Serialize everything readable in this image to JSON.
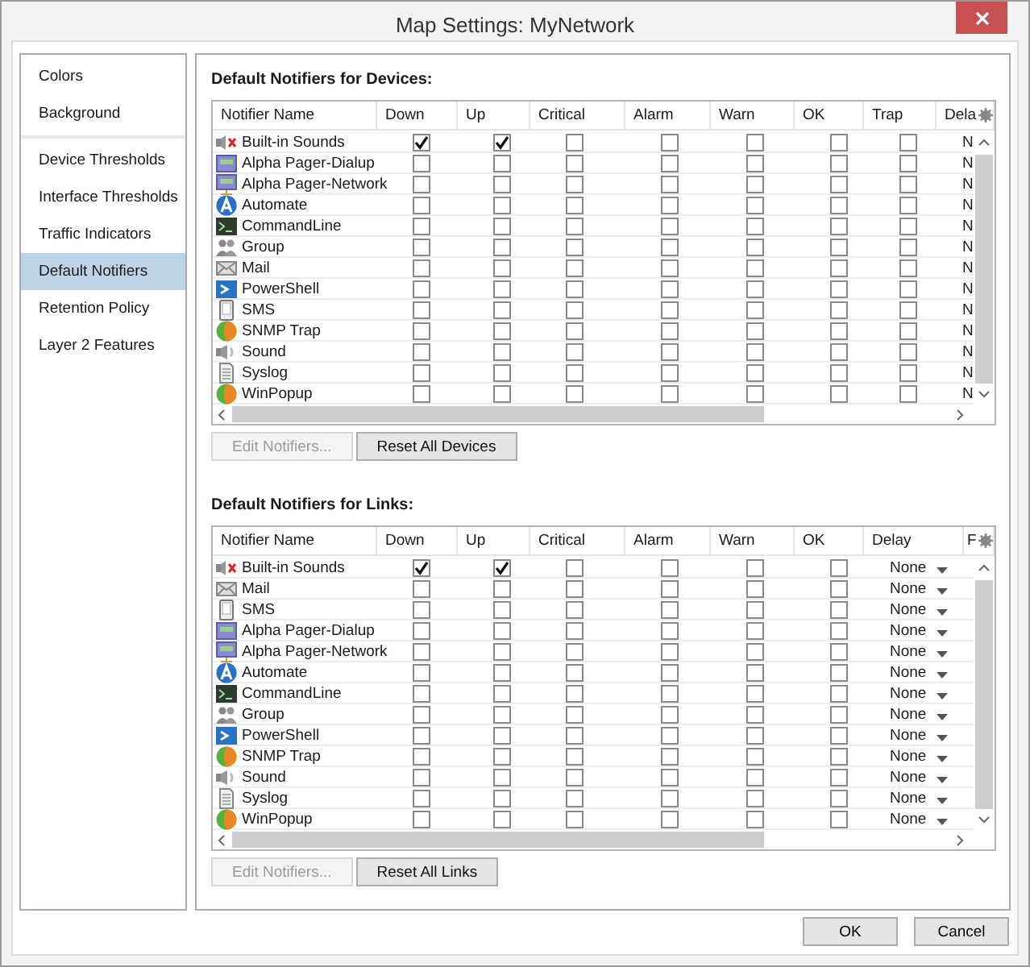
{
  "window": {
    "title": "Map Settings: MyNetwork"
  },
  "sidebar": {
    "groups": [
      {
        "items": [
          {
            "label": "Colors",
            "selected": false
          },
          {
            "label": "Background",
            "selected": false
          }
        ]
      },
      {
        "items": [
          {
            "label": "Device Thresholds",
            "selected": false
          },
          {
            "label": "Interface Thresholds",
            "selected": false
          },
          {
            "label": "Traffic Indicators",
            "selected": false
          },
          {
            "label": "Default Notifiers",
            "selected": true
          },
          {
            "label": "Retention Policy",
            "selected": false
          },
          {
            "label": "Layer 2 Features",
            "selected": false
          }
        ]
      }
    ]
  },
  "devices": {
    "heading": "Default Notifiers for Devices:",
    "columns": [
      {
        "label": "Notifier Name",
        "kind": "name"
      },
      {
        "label": "Down",
        "kind": "check"
      },
      {
        "label": "Up",
        "kind": "check"
      },
      {
        "label": "Critical",
        "kind": "check"
      },
      {
        "label": "Alarm",
        "kind": "check"
      },
      {
        "label": "Warn",
        "kind": "check"
      },
      {
        "label": "OK",
        "kind": "check"
      },
      {
        "label": "Trap",
        "kind": "check"
      },
      {
        "label": "Dela",
        "kind": "delay"
      }
    ],
    "rows": [
      {
        "name": "Built-in Sounds",
        "kind": "sound-muted",
        "checks": [
          true,
          true,
          false,
          false,
          false,
          false,
          false
        ],
        "delay": "N"
      },
      {
        "name": "Alpha Pager-Dialup",
        "kind": "pager",
        "checks": [
          false,
          false,
          false,
          false,
          false,
          false,
          false
        ],
        "delay": "N"
      },
      {
        "name": "Alpha Pager-Network",
        "kind": "pager-network",
        "checks": [
          false,
          false,
          false,
          false,
          false,
          false,
          false
        ],
        "delay": "N"
      },
      {
        "name": "Automate",
        "kind": "automate",
        "checks": [
          false,
          false,
          false,
          false,
          false,
          false,
          false
        ],
        "delay": "N"
      },
      {
        "name": "CommandLine",
        "kind": "terminal",
        "checks": [
          false,
          false,
          false,
          false,
          false,
          false,
          false
        ],
        "delay": "N"
      },
      {
        "name": "Group",
        "kind": "group",
        "checks": [
          false,
          false,
          false,
          false,
          false,
          false,
          false
        ],
        "delay": "N"
      },
      {
        "name": "Mail",
        "kind": "mail",
        "checks": [
          false,
          false,
          false,
          false,
          false,
          false,
          false
        ],
        "delay": "N"
      },
      {
        "name": "PowerShell",
        "kind": "powershell",
        "checks": [
          false,
          false,
          false,
          false,
          false,
          false,
          false
        ],
        "delay": "N"
      },
      {
        "name": "SMS",
        "kind": "phone",
        "checks": [
          false,
          false,
          false,
          false,
          false,
          false,
          false
        ],
        "delay": "N"
      },
      {
        "name": "SNMP Trap",
        "kind": "ball",
        "checks": [
          false,
          false,
          false,
          false,
          false,
          false,
          false
        ],
        "delay": "N"
      },
      {
        "name": "Sound",
        "kind": "sound",
        "checks": [
          false,
          false,
          false,
          false,
          false,
          false,
          false
        ],
        "delay": "N"
      },
      {
        "name": "Syslog",
        "kind": "document",
        "checks": [
          false,
          false,
          false,
          false,
          false,
          false,
          false
        ],
        "delay": "N"
      },
      {
        "name": "WinPopup",
        "kind": "ball",
        "checks": [
          false,
          false,
          false,
          false,
          false,
          false,
          false
        ],
        "delay": "N"
      }
    ],
    "buttons": [
      {
        "label": "Edit Notifiers...",
        "disabled": true
      },
      {
        "label": "Reset All Devices",
        "disabled": false
      }
    ]
  },
  "links": {
    "heading": "Default Notifiers for Links:",
    "columns": [
      {
        "label": "Notifier Name",
        "kind": "name"
      },
      {
        "label": "Down",
        "kind": "check"
      },
      {
        "label": "Up",
        "kind": "check"
      },
      {
        "label": "Critical",
        "kind": "check"
      },
      {
        "label": "Alarm",
        "kind": "check"
      },
      {
        "label": "Warn",
        "kind": "check"
      },
      {
        "label": "OK",
        "kind": "check"
      },
      {
        "label": "Delay",
        "kind": "dropdown"
      },
      {
        "label": "F",
        "kind": "blank"
      }
    ],
    "rows": [
      {
        "name": "Built-in Sounds",
        "kind": "sound-muted",
        "checks": [
          true,
          true,
          false,
          false,
          false,
          false
        ],
        "delay": "None"
      },
      {
        "name": "Mail",
        "kind": "mail",
        "checks": [
          false,
          false,
          false,
          false,
          false,
          false
        ],
        "delay": "None"
      },
      {
        "name": "SMS",
        "kind": "phone",
        "checks": [
          false,
          false,
          false,
          false,
          false,
          false
        ],
        "delay": "None"
      },
      {
        "name": "Alpha Pager-Dialup",
        "kind": "pager",
        "checks": [
          false,
          false,
          false,
          false,
          false,
          false
        ],
        "delay": "None"
      },
      {
        "name": "Alpha Pager-Network",
        "kind": "pager-network",
        "checks": [
          false,
          false,
          false,
          false,
          false,
          false
        ],
        "delay": "None"
      },
      {
        "name": "Automate",
        "kind": "automate",
        "checks": [
          false,
          false,
          false,
          false,
          false,
          false
        ],
        "delay": "None"
      },
      {
        "name": "CommandLine",
        "kind": "terminal",
        "checks": [
          false,
          false,
          false,
          false,
          false,
          false
        ],
        "delay": "None"
      },
      {
        "name": "Group",
        "kind": "group",
        "checks": [
          false,
          false,
          false,
          false,
          false,
          false
        ],
        "delay": "None"
      },
      {
        "name": "PowerShell",
        "kind": "powershell",
        "checks": [
          false,
          false,
          false,
          false,
          false,
          false
        ],
        "delay": "None"
      },
      {
        "name": "SNMP Trap",
        "kind": "ball",
        "checks": [
          false,
          false,
          false,
          false,
          false,
          false
        ],
        "delay": "None"
      },
      {
        "name": "Sound",
        "kind": "sound",
        "checks": [
          false,
          false,
          false,
          false,
          false,
          false
        ],
        "delay": "None"
      },
      {
        "name": "Syslog",
        "kind": "document",
        "checks": [
          false,
          false,
          false,
          false,
          false,
          false
        ],
        "delay": "None"
      },
      {
        "name": "WinPopup",
        "kind": "ball",
        "checks": [
          false,
          false,
          false,
          false,
          false,
          false
        ],
        "delay": "None"
      }
    ],
    "buttons": [
      {
        "label": "Edit Notifiers...",
        "disabled": true
      },
      {
        "label": "Reset All Links",
        "disabled": false
      }
    ]
  },
  "footer_buttons": [
    "OK",
    "Cancel"
  ]
}
